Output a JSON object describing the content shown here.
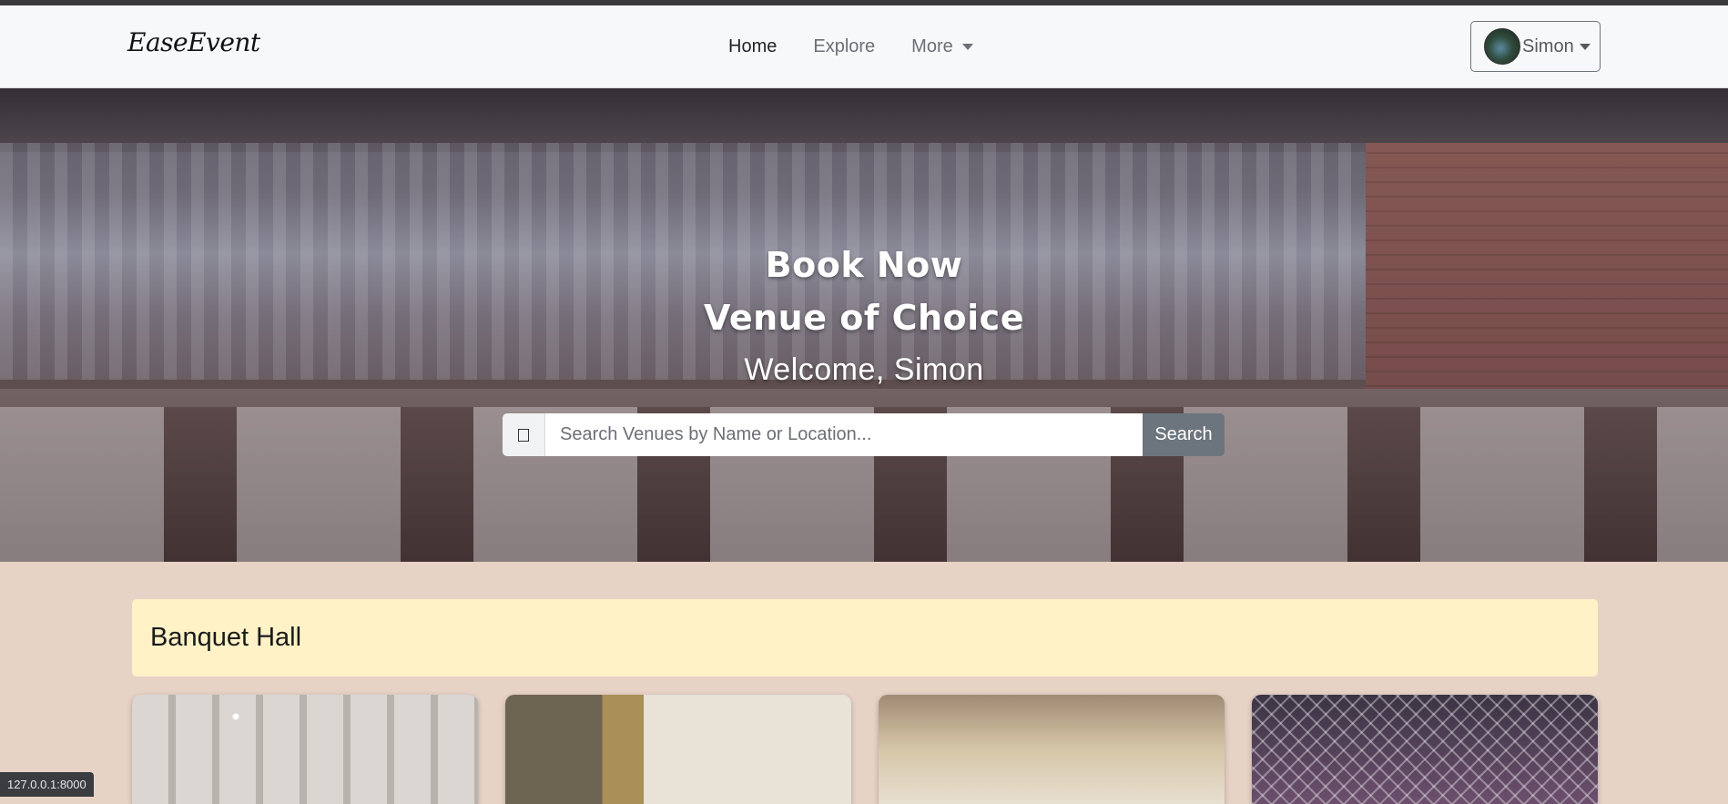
{
  "brand": "EaseEvent",
  "nav": {
    "home": "Home",
    "explore": "Explore",
    "more": "More"
  },
  "user": {
    "name": "Simon"
  },
  "hero": {
    "line1": "Book Now",
    "line2": "Venue of Choice",
    "welcome": "Welcome, Simon"
  },
  "search": {
    "placeholder": "Search Venues by Name or Location...",
    "button": "Search"
  },
  "section": {
    "title": "Banquet Hall"
  },
  "status_url": "127.0.0.1:8000"
}
